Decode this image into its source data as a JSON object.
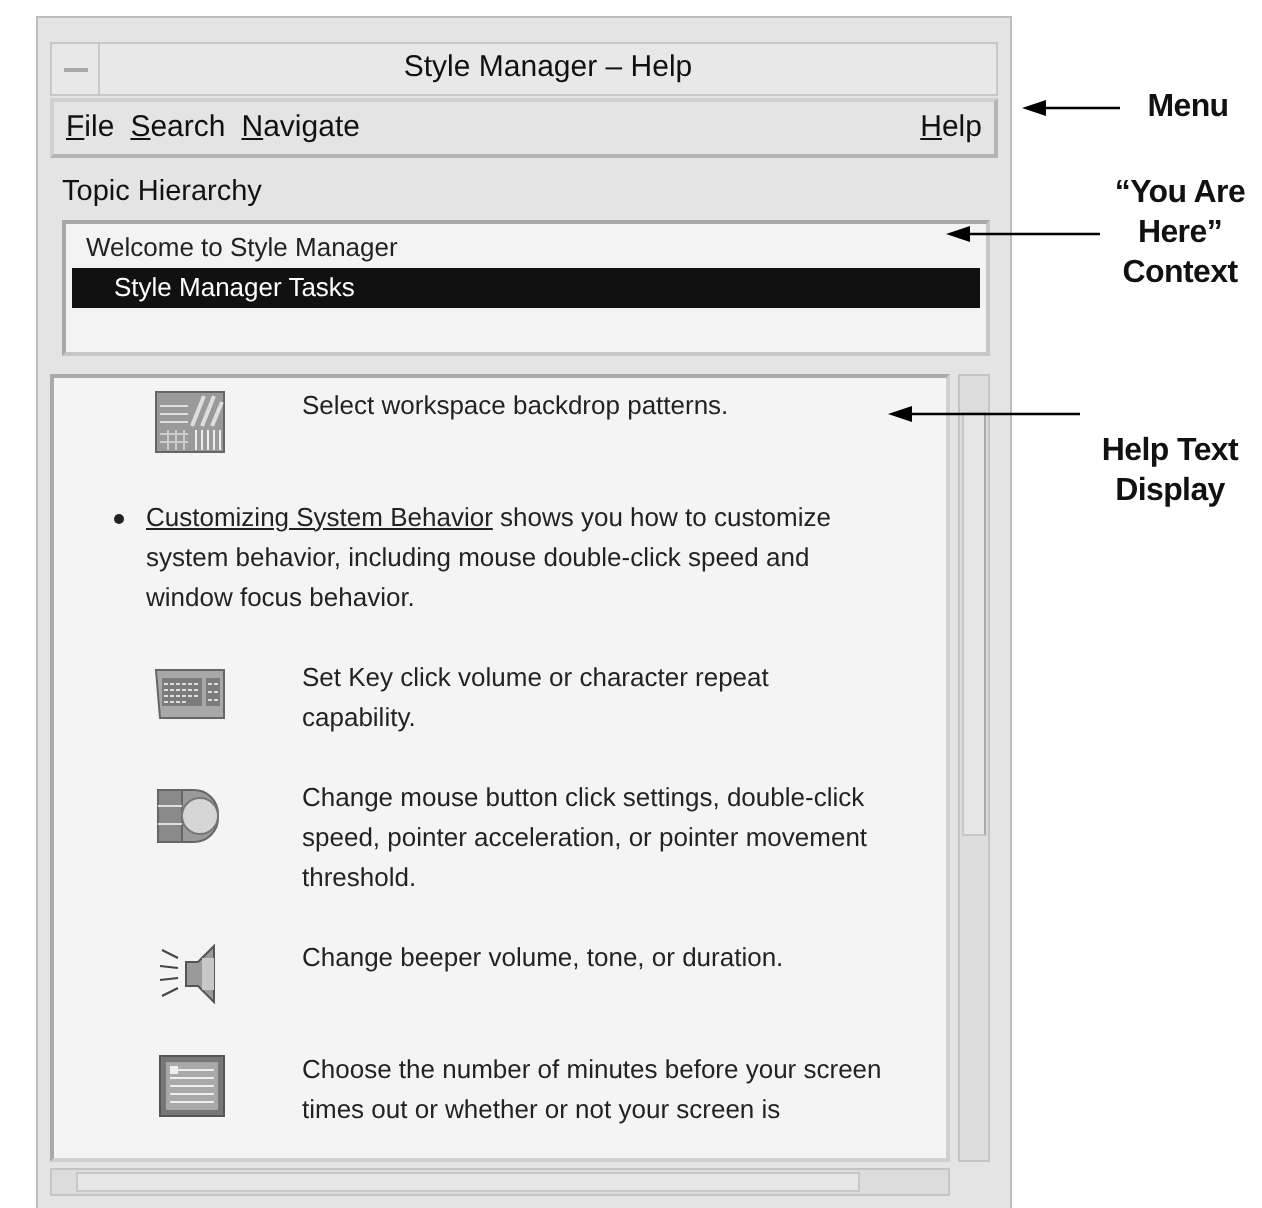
{
  "window": {
    "title": "Style Manager – Help"
  },
  "menu": {
    "items": [
      "File",
      "Search",
      "Navigate"
    ],
    "help": "Help"
  },
  "topic_hierarchy": {
    "label": "Topic Hierarchy",
    "items": [
      {
        "label": "Welcome to Style Manager",
        "selected": false,
        "children": [
          {
            "label": "Style Manager Tasks",
            "selected": true
          }
        ]
      }
    ]
  },
  "help_text": {
    "blocks": [
      {
        "kind": "icon_row",
        "text": "Select workspace backdrop patterns."
      },
      {
        "kind": "bullet",
        "link": "Customizing System Behavior",
        "text": " shows you how to customize system behavior, including mouse double‑click speed and window focus behavior."
      },
      {
        "kind": "icon_row",
        "text": "Set Key click volume or character repeat capability."
      },
      {
        "kind": "icon_row",
        "text": "Change mouse button click settings, double‑click speed, pointer acceleration, or pointer movement threshold."
      },
      {
        "kind": "icon_row",
        "text": "Change beeper volume, tone, or duration."
      },
      {
        "kind": "icon_row",
        "text": "Choose the number of minutes before your screen times out or whether or not your screen is"
      }
    ]
  },
  "callouts": [
    {
      "text": "Menu"
    },
    {
      "text": "“You Are Here” Context"
    },
    {
      "text": "Help Text Display"
    }
  ]
}
